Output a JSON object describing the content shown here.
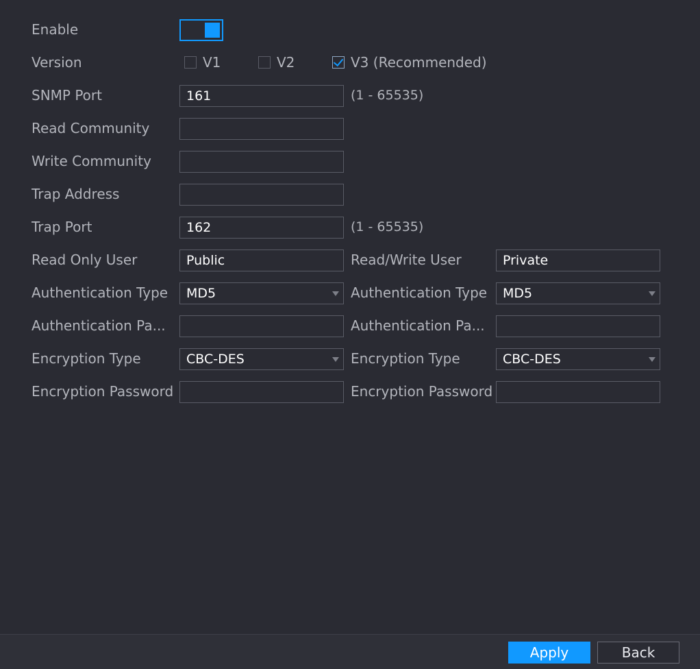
{
  "form": {
    "enable": {
      "label": "Enable",
      "on": true
    },
    "version": {
      "label": "Version",
      "options": [
        {
          "label": "V1",
          "checked": false
        },
        {
          "label": "V2",
          "checked": false
        },
        {
          "label": "V3 (Recommended)",
          "checked": true
        }
      ]
    },
    "snmp_port": {
      "label": "SNMP Port",
      "value": "161",
      "hint": "(1 - 65535)"
    },
    "read_community": {
      "label": "Read Community",
      "value": ""
    },
    "write_community": {
      "label": "Write Community",
      "value": ""
    },
    "trap_address": {
      "label": "Trap Address",
      "value": ""
    },
    "trap_port": {
      "label": "Trap Port",
      "value": "162",
      "hint": "(1 - 65535)"
    },
    "read_only": {
      "user_label": "Read Only User",
      "user_value": "Public",
      "auth_type_label": "Authentication Type",
      "auth_type_value": "MD5",
      "auth_password_label": "Authentication Pa...",
      "auth_password_value": "",
      "enc_type_label": "Encryption Type",
      "enc_type_value": "CBC-DES",
      "enc_password_label": "Encryption Password",
      "enc_password_value": ""
    },
    "read_write": {
      "user_label": "Read/Write User",
      "user_value": "Private",
      "auth_type_label": "Authentication Type",
      "auth_type_value": "MD5",
      "auth_password_label": "Authentication Pa...",
      "auth_password_value": "",
      "enc_type_label": "Encryption Type",
      "enc_type_value": "CBC-DES",
      "enc_password_label": "Encryption Password",
      "enc_password_value": ""
    }
  },
  "footer": {
    "apply_label": "Apply",
    "back_label": "Back"
  },
  "colors": {
    "accent": "#1199ff",
    "background": "#2a2b33",
    "text": "#b3b5bc"
  }
}
